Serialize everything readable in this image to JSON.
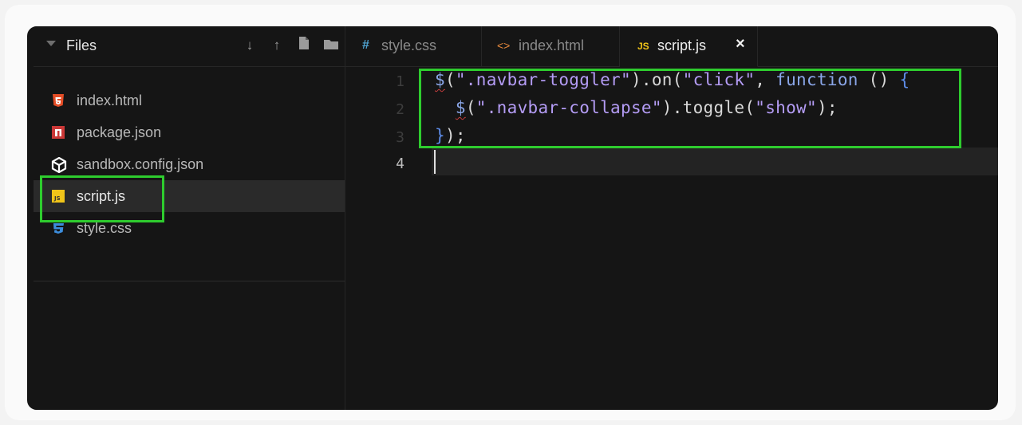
{
  "sidebar": {
    "title": "Files",
    "header_icons": [
      "arrow-down-icon",
      "arrow-up-icon",
      "new-file-icon",
      "new-folder-icon"
    ],
    "items": [
      {
        "label": "index.html",
        "icon": "html5-icon",
        "color": "#e44d26"
      },
      {
        "label": "package.json",
        "icon": "npm-icon",
        "color": "#cb3837"
      },
      {
        "label": "sandbox.config.json",
        "icon": "cube-icon",
        "color": "#ffffff"
      },
      {
        "label": "script.js",
        "icon": "js-icon",
        "color": "#f0c419",
        "active": true
      },
      {
        "label": "style.css",
        "icon": "css3-icon",
        "color": "#3c8ddc"
      }
    ]
  },
  "tabs": [
    {
      "label": "style.css",
      "icon_text": "#",
      "icon_color": "#4fa3d1"
    },
    {
      "label": "index.html",
      "icon_text": "<>",
      "icon_color": "#e88a3c"
    },
    {
      "label": "script.js",
      "icon_text": "JS",
      "icon_color": "#f0c419",
      "active": true,
      "close": "×"
    }
  ],
  "editor": {
    "line_numbers": [
      "1",
      "2",
      "3",
      "4"
    ],
    "active_line": 4,
    "lines": [
      "$(\".navbar-toggler\").on(\"click\", function () {",
      "  $(\".navbar-collapse\").toggle(\"show\");",
      "});",
      ""
    ]
  },
  "colors": {
    "highlight": "#2ecc2e",
    "background": "#151515"
  }
}
